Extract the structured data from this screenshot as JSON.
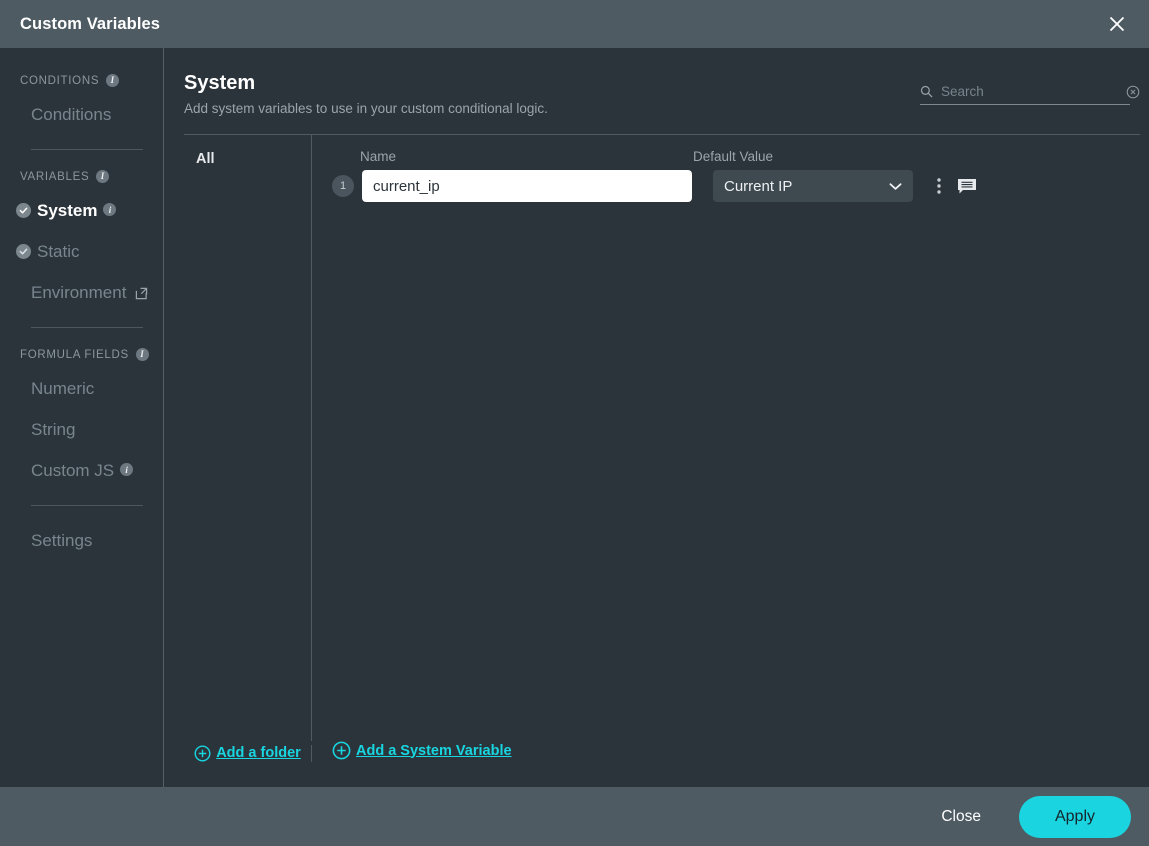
{
  "window": {
    "title": "Custom Variables",
    "close_icon": "close-icon"
  },
  "sidebar": {
    "groups": [
      {
        "label": "CONDITIONS",
        "has_info": true,
        "items": [
          {
            "label": "Conditions",
            "active": false,
            "check": false,
            "info": false,
            "external": false
          }
        ]
      },
      {
        "label": "VARIABLES",
        "has_info": true,
        "items": [
          {
            "label": "System",
            "active": true,
            "check": true,
            "info": true,
            "external": false
          },
          {
            "label": "Static",
            "active": false,
            "check": true,
            "info": false,
            "external": false
          },
          {
            "label": "Environment",
            "active": false,
            "check": false,
            "info": false,
            "external": true
          }
        ]
      },
      {
        "label": "FORMULA FIELDS",
        "has_info": true,
        "items": [
          {
            "label": "Numeric",
            "active": false,
            "check": false,
            "info": false,
            "external": false
          },
          {
            "label": "String",
            "active": false,
            "check": false,
            "info": false,
            "external": false
          },
          {
            "label": "Custom JS",
            "active": false,
            "check": false,
            "info": true,
            "external": false
          }
        ]
      },
      {
        "label": "",
        "has_info": false,
        "items": [
          {
            "label": "Settings",
            "active": false,
            "check": false,
            "info": false,
            "external": false
          }
        ]
      }
    ],
    "info_char": "i"
  },
  "main": {
    "title": "System",
    "subtitle": "Add system variables to use in your custom conditional logic.",
    "search": {
      "placeholder": "Search",
      "value": "",
      "icon": "search-icon",
      "clear_icon": "clear-circle-icon"
    },
    "folder_column": {
      "all_label": "All"
    },
    "columns": {
      "name": "Name",
      "default_value": "Default Value"
    },
    "rows": [
      {
        "index": "1",
        "name": "current_ip",
        "default_value": "Current IP",
        "menu_icon": "kebab-menu-icon",
        "comment_icon": "comment-icon"
      }
    ],
    "add_folder_label": "Add a folder",
    "add_variable_label": "Add a System Variable"
  },
  "footer": {
    "close_label": "Close",
    "apply_label": "Apply"
  },
  "colors": {
    "accent": "#1ad5e0",
    "titlebar": "#4e5b63",
    "body": "#2c343b",
    "select_bg": "#3e4950"
  }
}
